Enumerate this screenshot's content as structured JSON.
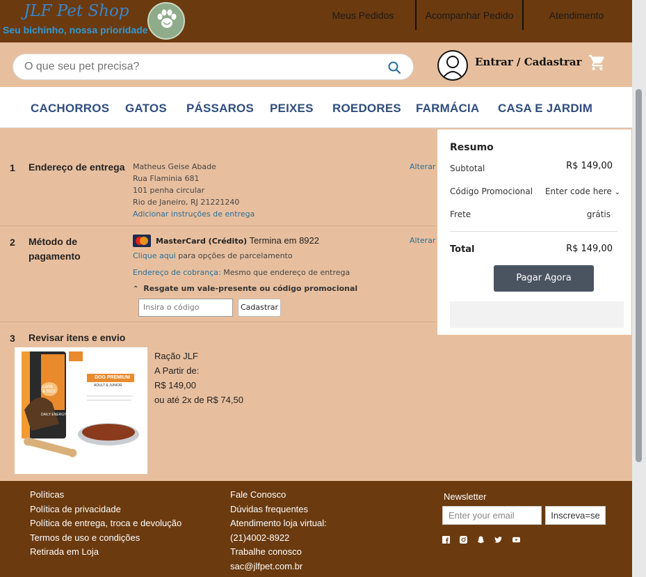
{
  "header": {
    "brand_name": "JLF Pet Shop",
    "tagline": "Seu bichinho, nossa prioridade",
    "nav": [
      "Meus Pedidos",
      "Acompanhar Pedido",
      "Atendimento"
    ]
  },
  "search": {
    "placeholder": "O que seu pet precisa?",
    "login_label": "Entrar / Cadastrar"
  },
  "categories": [
    "CACHORROS",
    "GATOS",
    "PÁSSAROS",
    "PEIXES",
    "ROEDORES",
    "FARMÁCIA",
    "CASA E JARDIM"
  ],
  "checkout": {
    "step1": {
      "number": "1",
      "title": "Endereço de entrega",
      "address": [
        "Matheus Geise Abade",
        "Rua Flaminia 681",
        "101 penha circular",
        "Rio de Janeiro, RJ 21221240"
      ],
      "instructions_link": "Adicionar instruções de entrega",
      "change": "Alterar"
    },
    "step2": {
      "number": "2",
      "title_line1": "Método de",
      "title_line2": "pagamento",
      "card_name": "MasterCard (Crédito)",
      "card_ending": "Termina em 8922",
      "installments_link": "Clique aqui",
      "installments_text": "para opções de parcelamento",
      "billing_link": "Endereço de cobrança:",
      "billing_text": "Mesmo que endereço de entrega",
      "redeem_label": "Resgate um vale-presente ou código promocional",
      "code_placeholder": "Insira o código",
      "register_button": "Cadastrar",
      "change": "Alterar"
    },
    "step3": {
      "number": "3",
      "title": "Revisar itens e envio"
    },
    "product": {
      "name": "Ração JLF",
      "from_label": "A Partir de:",
      "price": "R$ 149,00",
      "installment": "ou até 2x de R$ 74,50",
      "image_text": {
        "brand": "DOG PREMIUM",
        "sub": "ADULT & JUNIOR",
        "flavor": "Lamb & RICE",
        "energy": "DAILY ENERGY"
      }
    }
  },
  "summary": {
    "title": "Resumo",
    "subtotal_label": "Subtotal",
    "subtotal_value": "R$ 149,00",
    "promo_label": "Código Promocional",
    "promo_value": "Enter code here",
    "shipping_label": "Frete",
    "shipping_value": "grátis",
    "total_label": "Total",
    "total_value": "R$ 149,00",
    "pay_button": "Pagar Agora"
  },
  "footer": {
    "col1": [
      "Políticas",
      "Política de privacidade",
      "Política de entrega, troca e devolução",
      "Termos de uso e condições",
      "Retirada em Loja"
    ],
    "col2": [
      "Fale Conosco",
      "Dúvidas frequentes",
      "Atendimento loja virtual:",
      "(21)4002-8922",
      "Trabalhe conosco",
      "sac@jlfpet.com.br"
    ],
    "newsletter_title": "Newsletter",
    "newsletter_placeholder": "Enter your email",
    "newsletter_button": "Inscreva=se",
    "social_icons": [
      "facebook-icon",
      "instagram-icon",
      "snapchat-icon",
      "twitter-icon",
      "youtube-icon"
    ]
  },
  "colors": {
    "header_bg": "#6b3a0f",
    "band_bg": "#e8bf9e",
    "category_text": "#2f4d7e",
    "link": "#2a6f97",
    "pay_button": "#4a5461"
  }
}
